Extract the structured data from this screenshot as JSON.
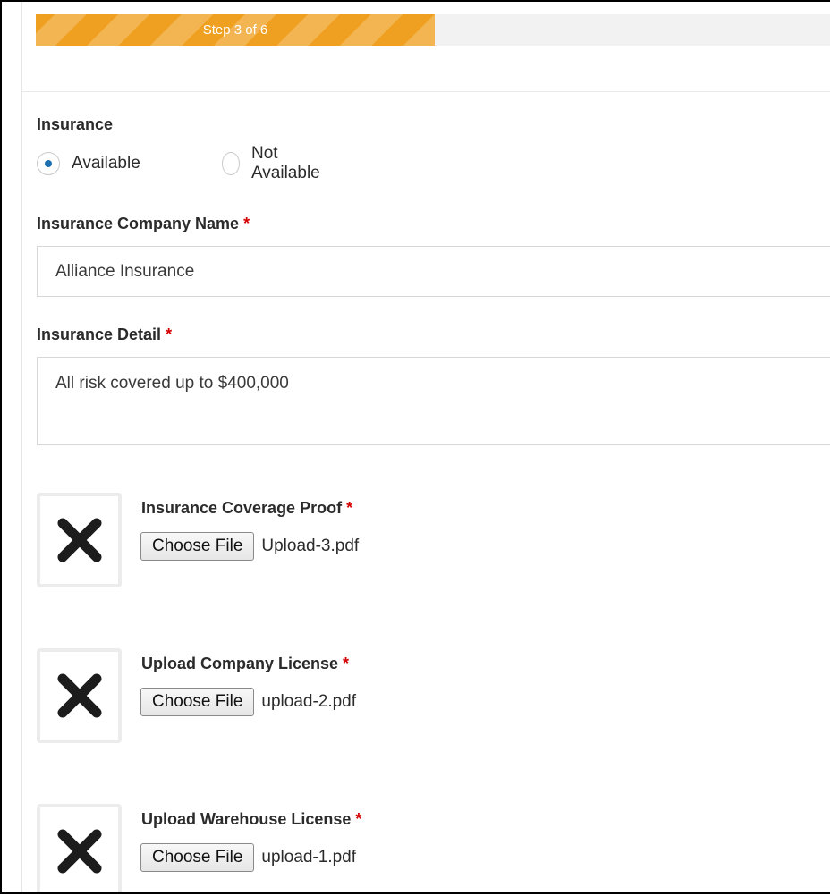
{
  "progress": {
    "label": "Step 3 of 6",
    "fraction": 0.5,
    "fill_color": "#f0a020"
  },
  "insurance": {
    "label": "Insurance",
    "options": [
      {
        "label": "Available",
        "selected": true
      },
      {
        "label": "Not Available",
        "selected": false
      }
    ]
  },
  "company_name": {
    "label": "Insurance Company Name",
    "required_mark": "*",
    "value": "Alliance Insurance"
  },
  "detail": {
    "label": "Insurance Detail",
    "required_mark": "*",
    "value": "All risk covered up to $400,000"
  },
  "uploads": [
    {
      "title": "Insurance Coverage Proof",
      "required_mark": "*",
      "button_label": "Choose File",
      "file_name": "Upload-3.pdf",
      "status_icon": "close-icon"
    },
    {
      "title": "Upload Company License",
      "required_mark": "*",
      "button_label": "Choose File",
      "file_name": "upload-2.pdf",
      "status_icon": "close-icon"
    },
    {
      "title": "Upload Warehouse License",
      "required_mark": "*",
      "button_label": "Choose File",
      "file_name": "upload-1.pdf",
      "status_icon": "close-icon"
    }
  ],
  "colors": {
    "accent": "#f0a020",
    "required": "#d40000",
    "radio_selected": "#1e6fb0"
  }
}
